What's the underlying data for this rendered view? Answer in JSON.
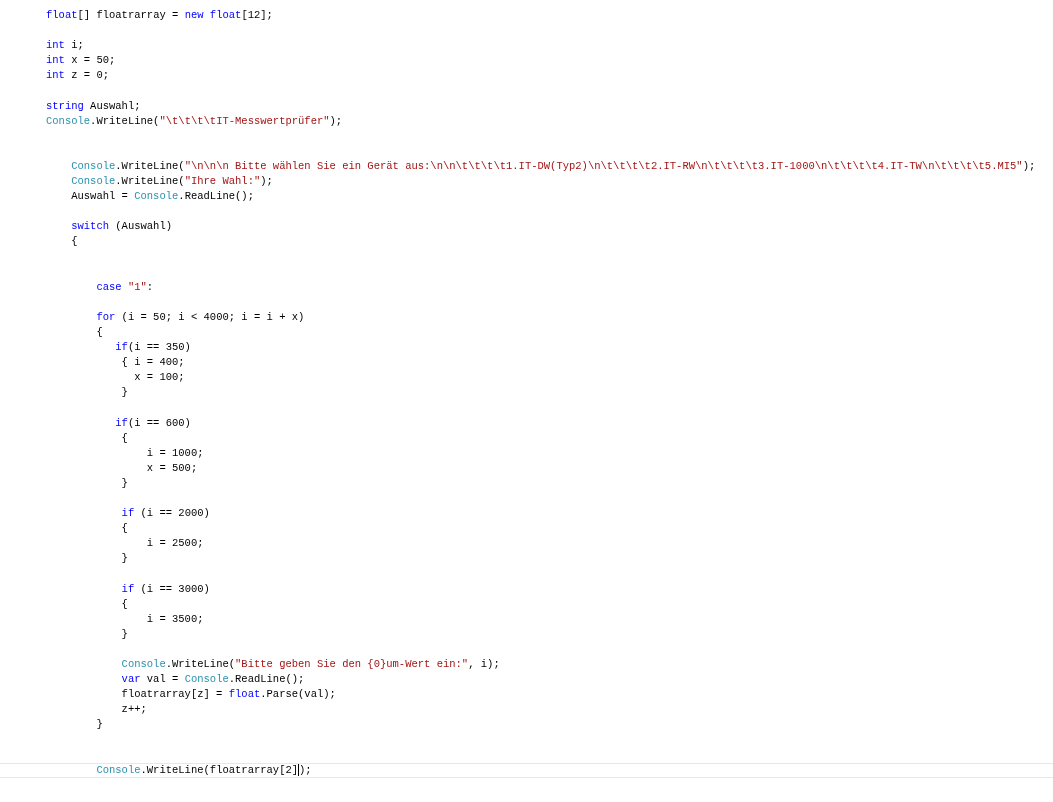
{
  "editor": {
    "lines": [
      {
        "tokens": [
          {
            "kind": "keyword",
            "text": "float"
          },
          {
            "kind": "plain",
            "text": "[] floatrarray = "
          },
          {
            "kind": "keyword",
            "text": "new "
          },
          {
            "kind": "keyword",
            "text": "float"
          },
          {
            "kind": "plain",
            "text": "[12];"
          }
        ]
      },
      {
        "blank_line_before": true,
        "tokens": [
          {
            "kind": "keyword",
            "text": "int"
          },
          {
            "kind": "plain",
            "text": " i;"
          }
        ]
      },
      {
        "tokens": [
          {
            "kind": "keyword",
            "text": "int"
          },
          {
            "kind": "plain",
            "text": " x = 50;"
          }
        ]
      },
      {
        "tokens": [
          {
            "kind": "keyword",
            "text": "int"
          },
          {
            "kind": "plain",
            "text": " z = 0;"
          }
        ]
      },
      {
        "blank_line_before": true,
        "tokens": [
          {
            "kind": "keyword",
            "text": "string"
          },
          {
            "kind": "plain",
            "text": " Auswahl;"
          }
        ]
      },
      {
        "tokens": [
          {
            "kind": "type",
            "text": "Console"
          },
          {
            "kind": "plain",
            "text": ".WriteLine("
          },
          {
            "kind": "string",
            "text": "\"\\t\\t\\t\\tIT-Messwertprüfer\""
          },
          {
            "kind": "plain",
            "text": ");"
          }
        ]
      },
      {
        "two_blank_lines_before": true,
        "tokens": [
          {
            "kind": "type",
            "text": "    Console"
          },
          {
            "kind": "plain",
            "text": ".WriteLine("
          },
          {
            "kind": "string",
            "text": "\"\\n\\n\\n Bitte wählen Sie ein Gerät aus:\\n\\n\\t\\t\\t\\t1.IT-DW(Typ2)\\n\\t\\t\\t\\t2.IT-RW\\n\\t\\t\\t\\t3.IT-1000\\n\\t\\t\\t\\t4.IT-TW\\n\\t\\t\\t\\t5.MI5\""
          },
          {
            "kind": "plain",
            "text": ");"
          }
        ]
      },
      {
        "tokens": [
          {
            "kind": "type",
            "text": "    Console"
          },
          {
            "kind": "plain",
            "text": ".WriteLine("
          },
          {
            "kind": "string",
            "text": "\"Ihre Wahl:\""
          },
          {
            "kind": "plain",
            "text": ");"
          }
        ]
      },
      {
        "tokens": [
          {
            "kind": "plain",
            "text": "    Auswahl = "
          },
          {
            "kind": "type",
            "text": "Console"
          },
          {
            "kind": "plain",
            "text": ".ReadLine();"
          }
        ]
      },
      {
        "blank_line_before": true,
        "tokens": [
          {
            "kind": "keyword",
            "text": "    switch"
          },
          {
            "kind": "plain",
            "text": " (Auswahl)"
          }
        ]
      },
      {
        "tokens": [
          {
            "kind": "plain",
            "text": "    {"
          }
        ]
      },
      {
        "two_blank_lines_before": true,
        "tokens": [
          {
            "kind": "keyword",
            "text": "        case "
          },
          {
            "kind": "string",
            "text": "\"1\""
          },
          {
            "kind": "plain",
            "text": ":"
          }
        ]
      },
      {
        "blank_line_before": true,
        "tokens": [
          {
            "kind": "keyword",
            "text": "        for"
          },
          {
            "kind": "plain",
            "text": " (i = 50; i < 4000; i = i + x)"
          }
        ]
      },
      {
        "tokens": [
          {
            "kind": "plain",
            "text": "        {"
          }
        ]
      },
      {
        "tokens": [
          {
            "kind": "keyword",
            "text": "           if"
          },
          {
            "kind": "plain",
            "text": "(i == 350)"
          }
        ]
      },
      {
        "tokens": [
          {
            "kind": "plain",
            "text": "            { i = 400;"
          }
        ]
      },
      {
        "tokens": [
          {
            "kind": "plain",
            "text": "              x = 100;"
          }
        ]
      },
      {
        "tokens": [
          {
            "kind": "plain",
            "text": "            }"
          }
        ]
      },
      {
        "blank_line_before": true,
        "tokens": [
          {
            "kind": "keyword",
            "text": "           if"
          },
          {
            "kind": "plain",
            "text": "(i == 600)"
          }
        ]
      },
      {
        "tokens": [
          {
            "kind": "plain",
            "text": "            {"
          }
        ]
      },
      {
        "tokens": [
          {
            "kind": "plain",
            "text": "                i = 1000;"
          }
        ]
      },
      {
        "tokens": [
          {
            "kind": "plain",
            "text": "                x = 500;"
          }
        ]
      },
      {
        "tokens": [
          {
            "kind": "plain",
            "text": "            }"
          }
        ]
      },
      {
        "blank_line_before": true,
        "tokens": [
          {
            "kind": "keyword",
            "text": "            if"
          },
          {
            "kind": "plain",
            "text": " (i == 2000)"
          }
        ]
      },
      {
        "tokens": [
          {
            "kind": "plain",
            "text": "            {"
          }
        ]
      },
      {
        "tokens": [
          {
            "kind": "plain",
            "text": "                i = 2500;"
          }
        ]
      },
      {
        "tokens": [
          {
            "kind": "plain",
            "text": "            }"
          }
        ]
      },
      {
        "blank_line_before": true,
        "tokens": [
          {
            "kind": "keyword",
            "text": "            if"
          },
          {
            "kind": "plain",
            "text": " (i == 3000)"
          }
        ]
      },
      {
        "tokens": [
          {
            "kind": "plain",
            "text": "            {"
          }
        ]
      },
      {
        "tokens": [
          {
            "kind": "plain",
            "text": "                i = 3500;"
          }
        ]
      },
      {
        "tokens": [
          {
            "kind": "plain",
            "text": "            }"
          }
        ]
      },
      {
        "blank_line_before": true,
        "tokens": [
          {
            "kind": "type",
            "text": "            Console"
          },
          {
            "kind": "plain",
            "text": ".WriteLine("
          },
          {
            "kind": "string",
            "text": "\"Bitte geben Sie den {0}um-Wert ein:\""
          },
          {
            "kind": "plain",
            "text": ", i);"
          }
        ]
      },
      {
        "tokens": [
          {
            "kind": "keyword",
            "text": "            var"
          },
          {
            "kind": "plain",
            "text": " val = "
          },
          {
            "kind": "type",
            "text": "Console"
          },
          {
            "kind": "plain",
            "text": ".ReadLine();"
          }
        ]
      },
      {
        "tokens": [
          {
            "kind": "plain",
            "text": "            floatrarray[z] = "
          },
          {
            "kind": "keyword",
            "text": "float"
          },
          {
            "kind": "plain",
            "text": ".Parse(val);"
          }
        ]
      },
      {
        "tokens": [
          {
            "kind": "plain",
            "text": "            z++;"
          }
        ]
      },
      {
        "tokens": [
          {
            "kind": "plain",
            "text": "        }"
          }
        ]
      },
      {
        "two_blank_lines_before": true,
        "current": true,
        "tokens": [
          {
            "kind": "type",
            "text": "        Console"
          },
          {
            "kind": "plain",
            "text": ".WriteLine(floatrarray[2]",
            "caret_after": true
          },
          {
            "kind": "plain",
            "text": ");"
          }
        ]
      }
    ]
  }
}
